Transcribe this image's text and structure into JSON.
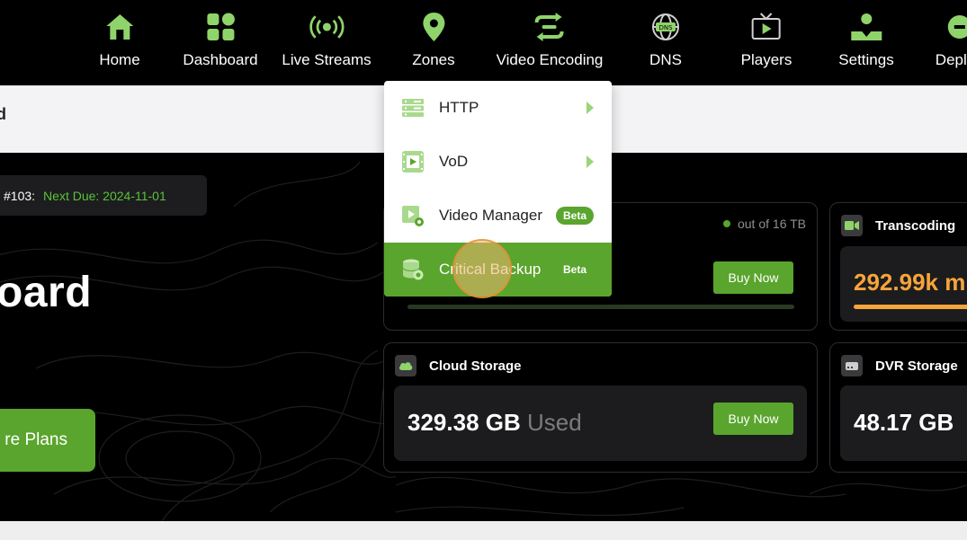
{
  "nav": {
    "items": [
      {
        "label": "Home",
        "icon": "home-icon"
      },
      {
        "label": "Dashboard",
        "icon": "dashboard-icon"
      },
      {
        "label": "Live Streams",
        "icon": "broadcast-icon"
      },
      {
        "label": "Zones",
        "icon": "location-pin-icon"
      },
      {
        "label": "Video Encoding",
        "icon": "encoding-arrows-icon"
      },
      {
        "label": "DNS",
        "icon": "dns-globe-icon"
      },
      {
        "label": "Players",
        "icon": "tv-player-icon"
      },
      {
        "label": "Settings",
        "icon": "settings-user-icon"
      },
      {
        "label": "Deplo",
        "icon": "deploy-icon"
      }
    ]
  },
  "subheader": {
    "text": "d"
  },
  "invoice": {
    "number": "#103:",
    "due": "Next Due: 2024-11-01"
  },
  "hero": {
    "title": "oard",
    "plans_button": "re Plans"
  },
  "storage_card": {
    "out_of": "out of 16 TB",
    "buy_label": "Buy Now"
  },
  "transcoding_card": {
    "title": "Transcoding",
    "value": "292.99k m"
  },
  "cloud_card": {
    "title": "Cloud Storage",
    "value": "329.38 GB",
    "used_word": "Used",
    "buy_label": "Buy Now"
  },
  "dvr_card": {
    "title": "DVR Storage",
    "value": "48.17 GB"
  },
  "dropdown": {
    "items": [
      {
        "label": "HTTP",
        "icon": "server-rack-icon",
        "has_submenu": true
      },
      {
        "label": "VoD",
        "icon": "film-icon",
        "has_submenu": true
      },
      {
        "label": "Video Manager",
        "icon": "video-settings-icon",
        "badge": "Beta"
      },
      {
        "label": "Critical Backup",
        "icon": "database-backup-icon",
        "badge": "Beta",
        "active": true
      }
    ]
  },
  "colors": {
    "accent": "#5aa52d",
    "orange": "#f7a43a",
    "nav_bg": "#000000",
    "icon_green": "#8fd46a"
  }
}
